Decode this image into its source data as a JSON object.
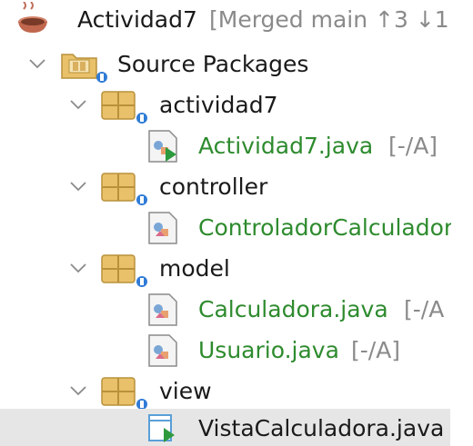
{
  "project": {
    "name": "Actividad7",
    "vcs_status": "[Merged main ↑3 ↓1",
    "icon": "coffee-cup-icon"
  },
  "source_packages": {
    "label": "Source Packages",
    "icon": "source-folder-icon"
  },
  "packages": [
    {
      "name": "actividad7",
      "files": [
        {
          "name": "Actividad7.java",
          "status": "[-/A]",
          "icon": "main-class-icon"
        }
      ]
    },
    {
      "name": "controller",
      "files": [
        {
          "name": "ControladorCalculador",
          "status": "",
          "icon": "java-class-icon"
        }
      ]
    },
    {
      "name": "model",
      "files": [
        {
          "name": "Calculadora.java",
          "status": "[-/A",
          "icon": "java-class-icon"
        },
        {
          "name": "Usuario.java",
          "status": "[-/A]",
          "icon": "java-class-icon"
        }
      ]
    },
    {
      "name": "view",
      "files": [
        {
          "name": "VistaCalculadora.java",
          "status": "",
          "icon": "form-file-icon",
          "selected": true
        }
      ]
    }
  ],
  "colors": {
    "added_file_text": "#2e8b2e",
    "status_text": "#8a8a8a",
    "selection_bg": "#e6e6e6",
    "package_icon": "#e8c16a"
  }
}
